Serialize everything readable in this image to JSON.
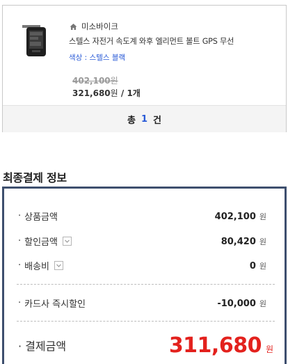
{
  "product": {
    "shop_name": "미소바이크",
    "name": "스텔스 자전거 속도계 와후 엘리먼트 볼트 GPS 무선",
    "option": "색상 : 스텔스 블랙",
    "original_price": "402,100",
    "original_unit": "원",
    "sale_price": "321,680",
    "sale_unit": "원",
    "quantity_text": " / 1개"
  },
  "footer": {
    "total_prefix": "총",
    "count": "1",
    "suffix": "건"
  },
  "payment": {
    "title": "최종결제 정보",
    "rows": [
      {
        "label": "상품금액",
        "value": "402,100",
        "unit": "원"
      },
      {
        "label": "할인금액",
        "value": "80,420",
        "unit": "원"
      },
      {
        "label": "배송비",
        "value": "0",
        "unit": "원"
      },
      {
        "label": "카드사 즉시할인",
        "value": "-10,000",
        "unit": "원"
      }
    ],
    "bullet": "·",
    "total": {
      "label": "결제금액",
      "value": "311,680",
      "unit": "원"
    }
  },
  "colors": {
    "accent_blue": "#2a5bd7",
    "total_red": "#e3211d",
    "box_border": "#3e4f6e"
  }
}
